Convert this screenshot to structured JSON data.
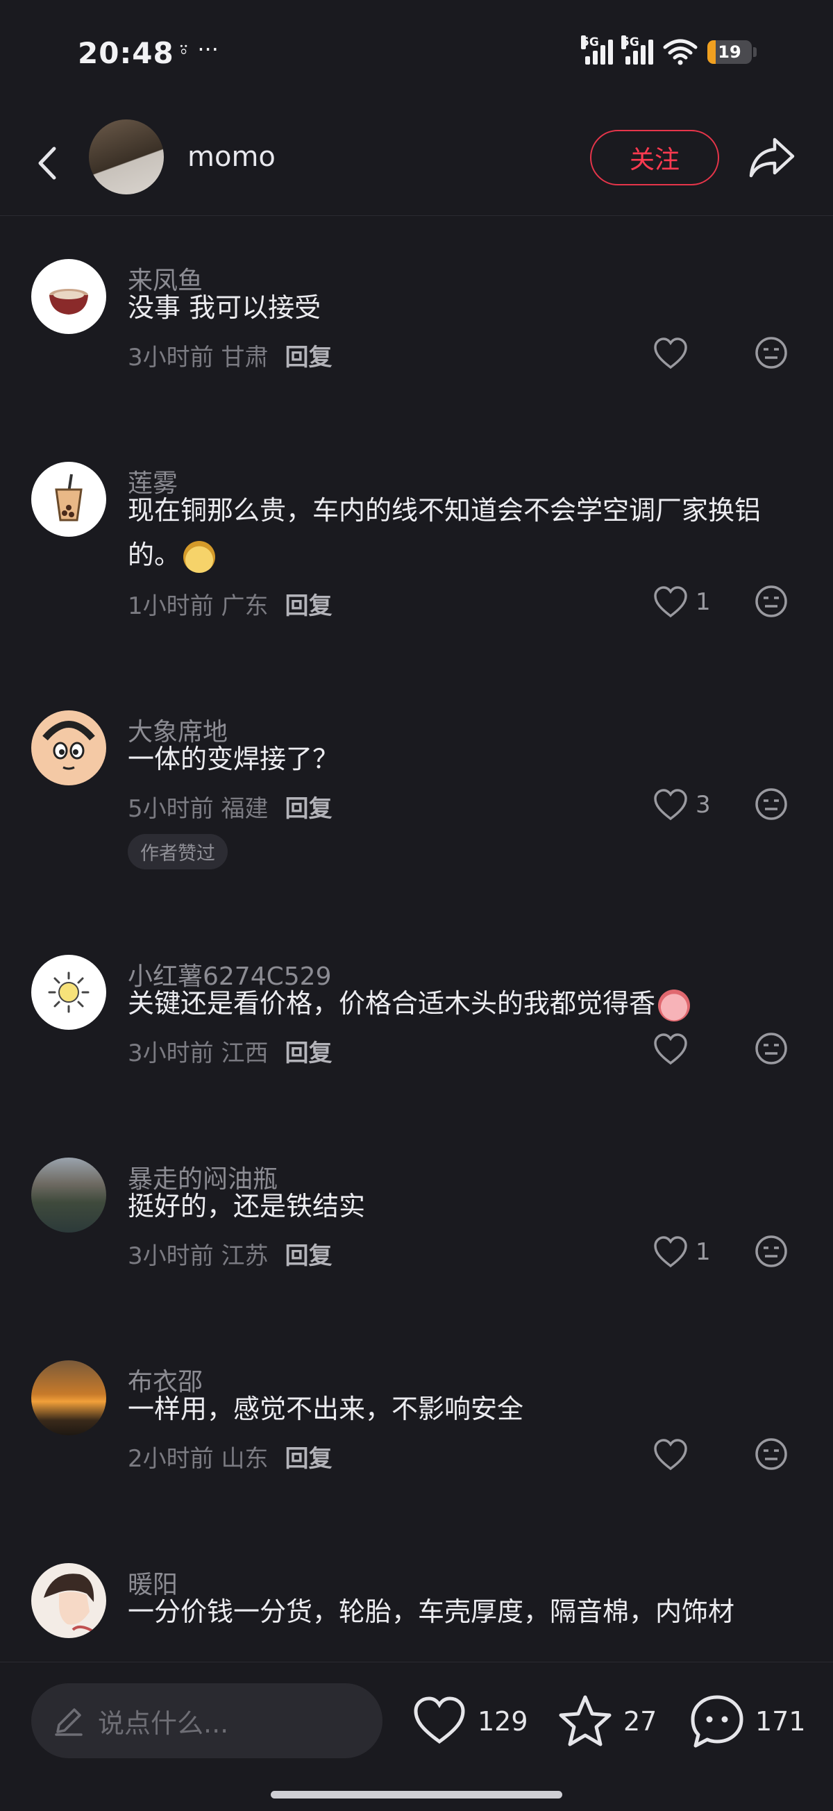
{
  "status": {
    "time": "20:48",
    "extra": "֌  ···",
    "network": "5G",
    "battery": "19"
  },
  "header": {
    "username": "momo",
    "follow_label": "关注"
  },
  "comments": [
    {
      "name": "来凤鱼",
      "text": "没事 我可以接受",
      "time": "3小时前",
      "region": "甘肃",
      "reply": "回复",
      "likes": ""
    },
    {
      "name": "莲雾",
      "text": "现在铜那么贵，车内的线不知道会不会学空调厂家换铝的。",
      "time": "1小时前",
      "region": "广东",
      "reply": "回复",
      "likes": "1"
    },
    {
      "name": "大象席地",
      "text": "一体的变焊接了？",
      "time": "5小时前",
      "region": "福建",
      "reply": "回复",
      "likes": "3",
      "badge": "作者赞过"
    },
    {
      "name": "小红薯6274C529",
      "text": "关键还是看价格，价格合适木头的我都觉得香",
      "time": "3小时前",
      "region": "江西",
      "reply": "回复",
      "likes": ""
    },
    {
      "name": "暴走的闷油瓶",
      "text": "挺好的，还是铁结实",
      "time": "3小时前",
      "region": "江苏",
      "reply": "回复",
      "likes": "1"
    },
    {
      "name": "布衣邵",
      "text": "一样用，感觉不出来，不影响安全",
      "time": "2小时前",
      "region": "山东",
      "reply": "回复",
      "likes": ""
    },
    {
      "name": "暖阳",
      "text": "一分价钱一分货，轮胎，车壳厚度，隔音棉，内饰材",
      "time": "",
      "region": "",
      "reply": "",
      "likes": ""
    }
  ],
  "bottom": {
    "placeholder": "说点什么...",
    "likes": "129",
    "stars": "27",
    "comments": "171"
  },
  "colors": {
    "background": "#1a1a1f",
    "accent": "#ff3a50"
  }
}
